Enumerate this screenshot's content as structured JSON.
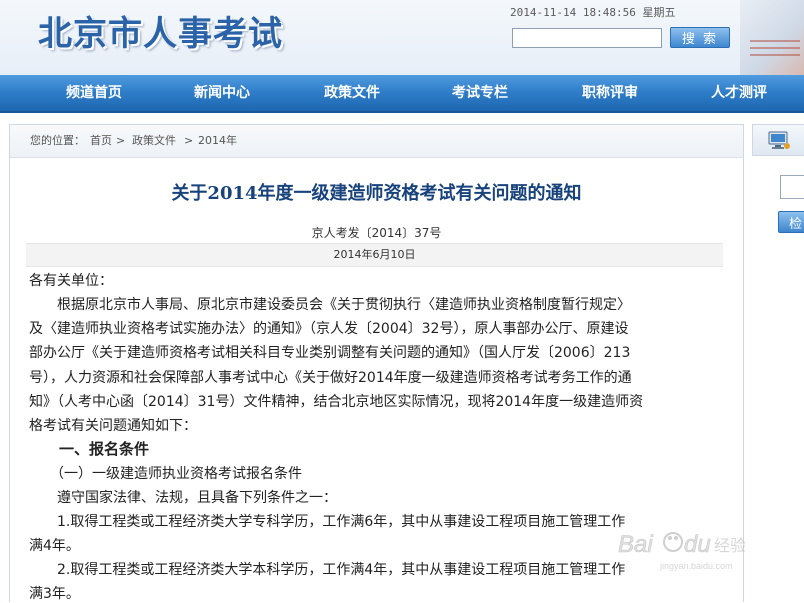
{
  "header": {
    "site_title": "北京市人事考试",
    "datetime": "2014-11-14 18:48:56 星期五",
    "search": {
      "value": "",
      "placeholder": "",
      "button_label": "搜 索"
    }
  },
  "nav": [
    {
      "label": "频道首页"
    },
    {
      "label": "新闻中心"
    },
    {
      "label": "政策文件"
    },
    {
      "label": "考试专栏"
    },
    {
      "label": "职称评审"
    },
    {
      "label": "人才测评"
    }
  ],
  "breadcrumb": {
    "prefix": "您的位置：",
    "items": [
      "首页",
      "政策文件",
      "2014年"
    ],
    "separator": ">"
  },
  "article": {
    "title": "关于2014年度一级建造师资格考试有关问题的通知",
    "doc_number": "京人考发〔2014〕37号",
    "date": "2014年6月10日",
    "lines": [
      "各有关单位：",
      "　　根据原北京市人事局、原北京市建设委员会《关于贯彻执行〈建造师执业资格制度暂行规定〉",
      "及〈建造师执业资格考试实施办法〉的通知》（京人发〔2004〕32号），原人事部办公厅、原建设",
      "部办公厅《关于建造师资格考试相关科目专业类别调整有关问题的通知》（国人厅发〔2006〕213",
      "号），人力资源和社会保障部人事考试中心《关于做好2014年度一级建造师资格考试考务工作的通",
      "知》（人考中心函〔2014〕31号）文件精神，结合北京地区实际情况，现将2014年度一级建造师资",
      "格考试有关问题通知如下：",
      "　　一、报名条件",
      "　　（一）一级建造师执业资格考试报名条件",
      "　　遵守国家法律、法规，且具备下列条件之一：",
      "　　1.取得工程类或工程经济类大学专科学历，工作满6年，其中从事建设工程项目施工管理工作",
      "满4年。",
      "　　2.取得工程类或工程经济类大学本科学历，工作满4年，其中从事建设工程项目施工管理工作",
      "满3年。"
    ]
  },
  "sidebar": {
    "input_value": "",
    "button_label": "检"
  },
  "watermark": {
    "brand": "Baidu",
    "suffix": "经验",
    "url": "jingyan.baidu.com"
  },
  "colors": {
    "title_blue": "#2a63a8",
    "nav_blue": "#2e7cc8",
    "article_title": "#17427c"
  }
}
